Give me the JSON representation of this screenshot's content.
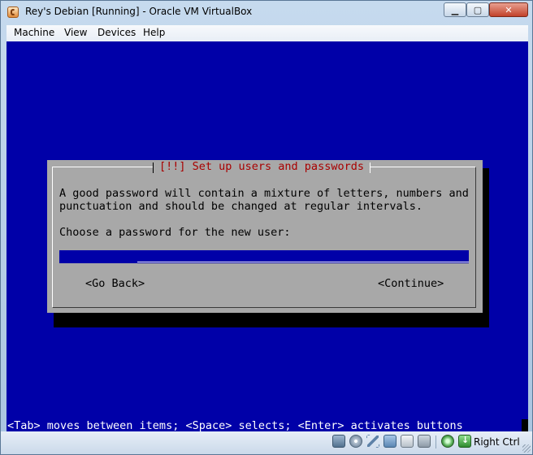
{
  "window": {
    "title": "Rey's Debian [Running] - Oracle VM VirtualBox",
    "minimize": "▁",
    "maximize": "▢",
    "close": "✕"
  },
  "menu": {
    "items": [
      "Machine",
      "View",
      "Devices",
      "Help"
    ]
  },
  "installer": {
    "dialog_title": "[!!] Set up users and passwords",
    "description_line1": "A good password will contain a mixture of letters, numbers and",
    "description_line2": "punctuation and should be changed at regular intervals.",
    "prompt": "Choose a password for the new user:",
    "password_mask": "************",
    "go_back": "<Go Back>",
    "continue": "<Continue>",
    "help_line": "<Tab> moves between items; <Space> selects; <Enter> activates buttons"
  },
  "statusbar": {
    "host_key": "Right Ctrl",
    "icons": [
      "hard-disk-icon",
      "optical-drive-icon",
      "usb-icon",
      "network-icon",
      "shared-folders-icon",
      "video-capture-icon",
      "mouse-integration-icon",
      "keyboard-capture-icon"
    ]
  },
  "colors": {
    "vm_background": "#0000a8",
    "dialog_background": "#a8a8a8",
    "dialog_title": "#a80000"
  }
}
